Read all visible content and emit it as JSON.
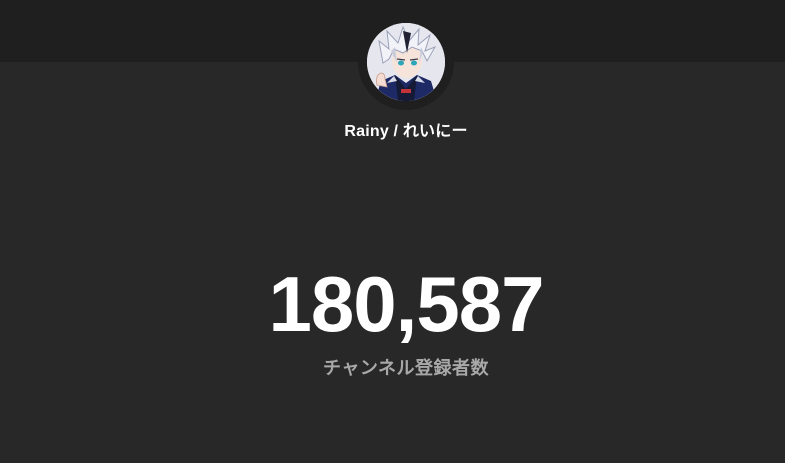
{
  "channel": {
    "name": "Rainy / れいにー",
    "avatar_icon": "channel-avatar-icon"
  },
  "stats": {
    "subscriber_count": "180,587",
    "subscriber_label": "チャンネル登録者数"
  },
  "colors": {
    "background": "#282828",
    "top_band": "#1f1f1f",
    "count_text": "#ffffff",
    "label_text": "#a8a8a8"
  }
}
